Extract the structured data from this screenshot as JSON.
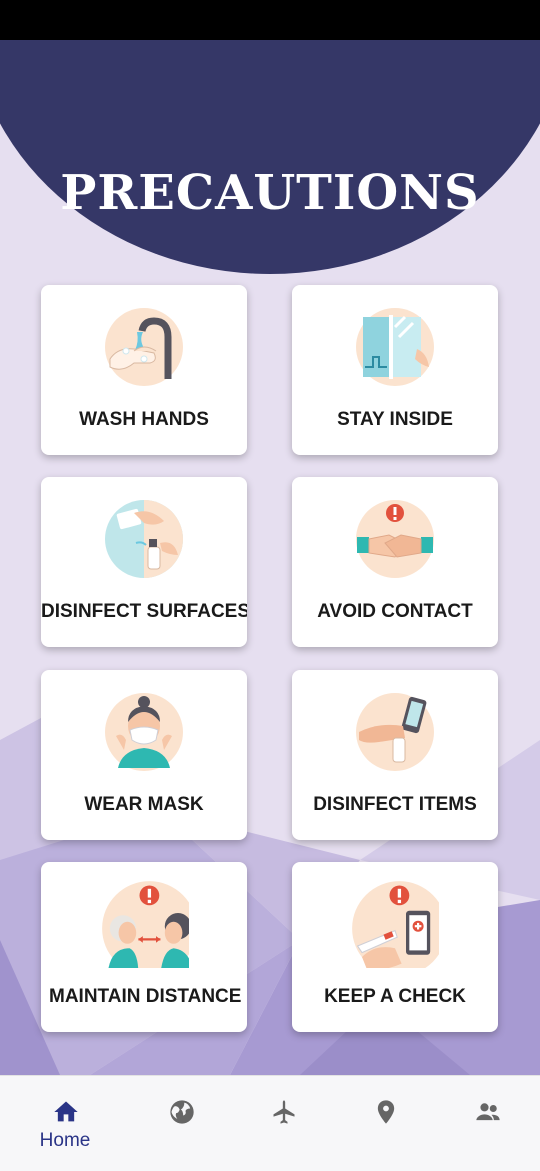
{
  "page_title": "PRECAUTIONS",
  "cards": [
    {
      "label": "WASH HANDS",
      "icon": "wash-hands-icon"
    },
    {
      "label": "STAY INSIDE",
      "icon": "stay-inside-icon"
    },
    {
      "label": "DISINFECT SURFACES",
      "icon": "disinfect-surfaces-icon"
    },
    {
      "label": "AVOID CONTACT",
      "icon": "avoid-contact-icon"
    },
    {
      "label": "WEAR MASK",
      "icon": "wear-mask-icon"
    },
    {
      "label": "DISINFECT ITEMS",
      "icon": "disinfect-items-icon"
    },
    {
      "label": "MAINTAIN DISTANCE",
      "icon": "maintain-distance-icon"
    },
    {
      "label": "KEEP A CHECK",
      "icon": "keep-a-check-icon"
    }
  ],
  "bottom_nav": {
    "active_label": "Home",
    "items": [
      "home-icon",
      "globe-icon",
      "airplane-icon",
      "location-pin-icon",
      "people-icon"
    ]
  },
  "colors": {
    "header": "#353767",
    "background": "#e6dff0",
    "nav_active": "#2a3487",
    "nav_inactive": "#666666",
    "icon_peach": "#fbe3cf",
    "icon_teal": "#2eb8b1",
    "icon_alert": "#e2513d"
  }
}
